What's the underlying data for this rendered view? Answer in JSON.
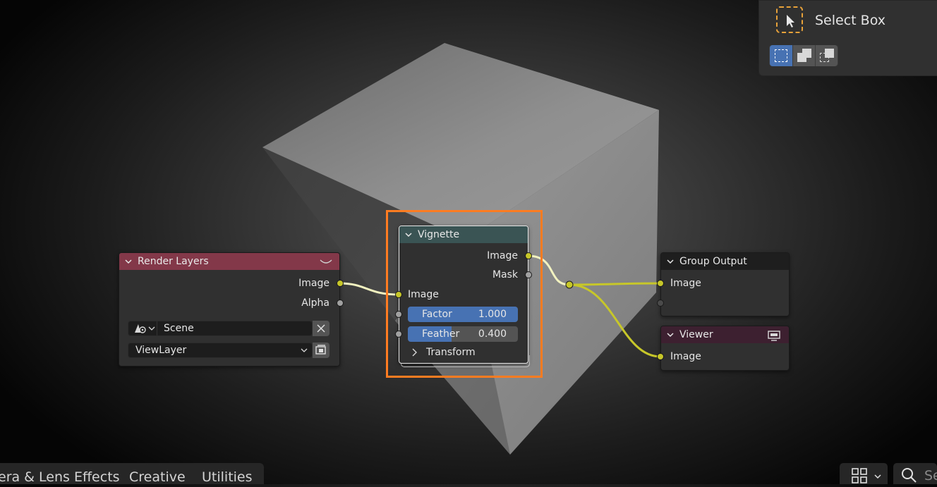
{
  "colors": {
    "accent_blue": "#4772b3",
    "socket_yellow": "#c7c729",
    "socket_grey": "#a1a1a1",
    "highlight_orange": "#ff7c21",
    "render_layers_header": "#833849",
    "vignette_header": "#3a5454",
    "group_output_header": "#1e1e1e",
    "viewer_header": "#3d2030"
  },
  "toolbar": {
    "tool_label": "Select Box",
    "modes": [
      "set-selection",
      "extend-selection",
      "subtract-selection"
    ]
  },
  "render_layers": {
    "title": "Render Layers",
    "outputs": [
      "Image",
      "Alpha"
    ],
    "scene": "Scene",
    "view_layer": "ViewLayer"
  },
  "vignette": {
    "title": "Vignette",
    "outputs": [
      "Image",
      "Mask"
    ],
    "input_image": "Image",
    "factor_label": "Factor",
    "factor_value": "1.000",
    "factor_fill": 1.0,
    "feather_label": "Feather",
    "feather_value": "0.400",
    "feather_fill": 0.4,
    "transform_label": "Transform"
  },
  "group_output": {
    "title": "Group Output",
    "input": "Image"
  },
  "viewer": {
    "title": "Viewer",
    "input": "Image"
  },
  "bottom_tabs": [
    "era & Lens Effects",
    "Creative",
    "Utilities"
  ],
  "search_placeholder": "Se"
}
